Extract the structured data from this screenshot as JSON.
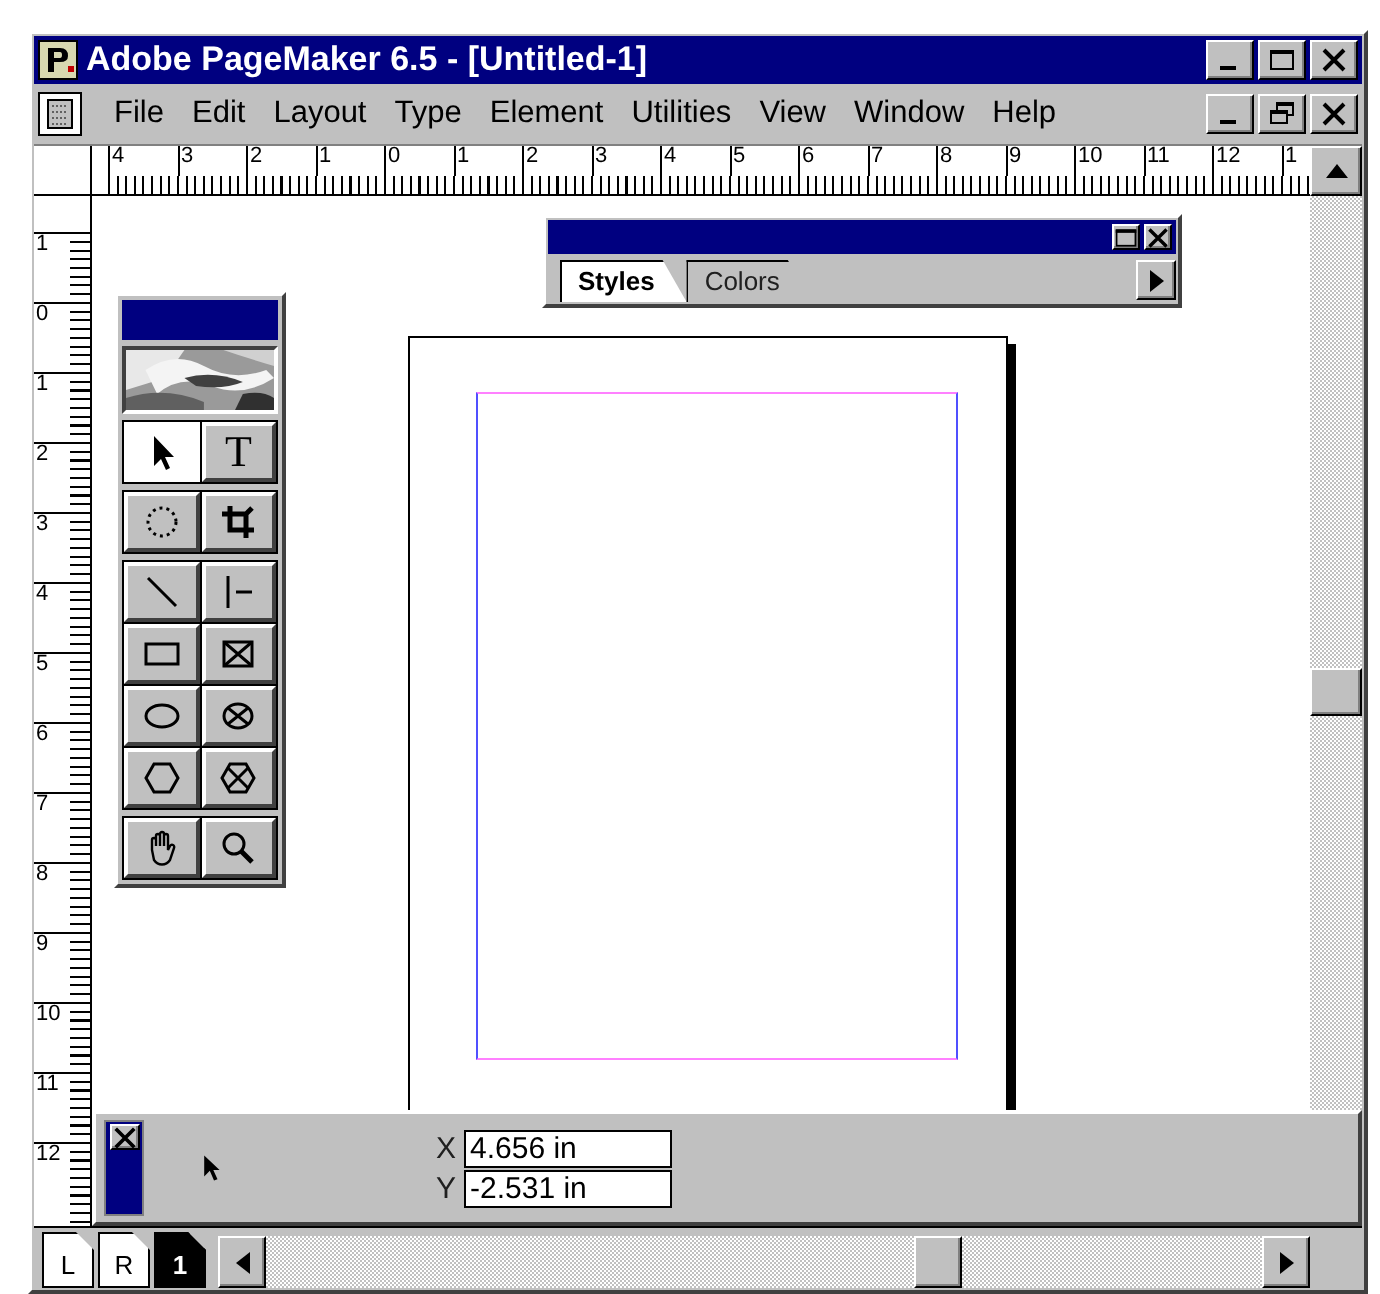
{
  "window": {
    "title": "Adobe PageMaker 6.5 - [Untitled-1]"
  },
  "menu": [
    "File",
    "Edit",
    "Layout",
    "Type",
    "Element",
    "Utilities",
    "View",
    "Window",
    "Help"
  ],
  "horizontal_ruler": [
    "4",
    "3",
    "2",
    "1",
    "0",
    "1",
    "2",
    "3",
    "4",
    "5",
    "6",
    "7",
    "8",
    "9",
    "10",
    "11",
    "12",
    "1"
  ],
  "vertical_ruler": [
    "1",
    "0",
    "1",
    "2",
    "3",
    "4",
    "5",
    "6",
    "7",
    "8",
    "9",
    "10",
    "11",
    "12"
  ],
  "styles_palette": {
    "tabs": [
      {
        "label": "Styles",
        "selected": true
      },
      {
        "label": "Colors",
        "selected": false
      }
    ]
  },
  "toolbox": {
    "tools": [
      {
        "kind": "pointer",
        "selected": true
      },
      {
        "kind": "text",
        "glyph": "T",
        "selected": false
      },
      {
        "kind": "rotate",
        "selected": false
      },
      {
        "kind": "crop",
        "selected": false
      },
      {
        "kind": "line",
        "selected": false
      },
      {
        "kind": "constrained-line",
        "selected": false
      },
      {
        "kind": "rectangle",
        "selected": false
      },
      {
        "kind": "rectangle-frame",
        "selected": false
      },
      {
        "kind": "ellipse",
        "selected": false
      },
      {
        "kind": "ellipse-frame",
        "selected": false
      },
      {
        "kind": "polygon",
        "selected": false
      },
      {
        "kind": "polygon-frame",
        "selected": false
      },
      {
        "kind": "hand",
        "selected": false
      },
      {
        "kind": "zoom",
        "selected": false
      }
    ]
  },
  "control_palette": {
    "fields": [
      {
        "label": "X",
        "value": "4.656 in"
      },
      {
        "label": "Y",
        "value": "-2.531 in"
      }
    ]
  },
  "page_icons": [
    {
      "label": "L",
      "selected": false
    },
    {
      "label": "R",
      "selected": false
    },
    {
      "label": "1",
      "selected": true
    }
  ]
}
